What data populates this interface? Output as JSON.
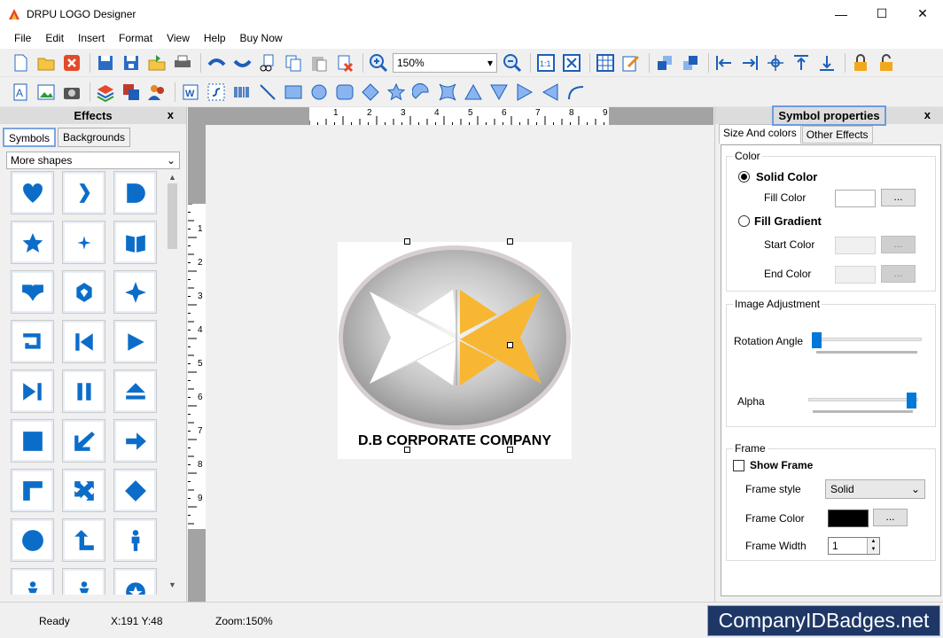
{
  "window": {
    "title": "DRPU LOGO Designer",
    "controls": {
      "minimize": "—",
      "maximize": "☐",
      "close": "✕"
    }
  },
  "menu": [
    "File",
    "Edit",
    "Insert",
    "Format",
    "View",
    "Help",
    "Buy Now"
  ],
  "toolbar": {
    "zoom_value": "150%",
    "icons_row1": [
      "new-icon",
      "open-icon",
      "close-doc-icon",
      "save-icon",
      "save-as-icon",
      "export-icon",
      "print-icon",
      "undo-icon",
      "redo-icon",
      "cut-icon",
      "copy-icon",
      "paste-icon",
      "delete-icon",
      "zoom-in-icon",
      "zoom-out-icon",
      "actual-size-icon",
      "fit-icon",
      "grid-icon",
      "edit-icon",
      "bring-front-icon",
      "send-back-icon",
      "align-left-icon",
      "align-right-icon",
      "align-center-icon",
      "align-top-icon",
      "align-bottom-icon",
      "lock-icon",
      "unlock-icon"
    ],
    "icons_row2": [
      "text-icon",
      "image-icon",
      "camera-icon",
      "layers-icon",
      "shapes-icon",
      "users-icon",
      "word-art-icon",
      "signature-icon",
      "barcode-icon",
      "line-icon",
      "rectangle-icon",
      "ellipse-icon",
      "rounded-rect-icon",
      "diamond-icon",
      "star-icon",
      "arc-icon",
      "star4-icon",
      "triangle-icon",
      "triangle-down-icon",
      "triangle-right-icon",
      "triangle-left-icon",
      "curve-icon"
    ]
  },
  "effects_panel": {
    "title": "Effects",
    "close": "x",
    "tabs": [
      "Symbols",
      "Backgrounds"
    ],
    "shape_category": "More shapes",
    "symbols": [
      "heart",
      "chevron-right",
      "d-shape",
      "star",
      "sparkle",
      "book-open",
      "book-heart",
      "shield-gem",
      "star4",
      "banner",
      "skip-back",
      "play",
      "skip-forward",
      "pause",
      "eject",
      "square",
      "arrow-down-left",
      "arrow-right",
      "corner",
      "expand",
      "diamond",
      "circle",
      "turn-up",
      "person",
      "person-small",
      "person-small",
      "badge"
    ]
  },
  "canvas": {
    "ruler_h": [
      "1",
      "2",
      "3",
      "4",
      "5",
      "6",
      "7",
      "8",
      "9"
    ],
    "ruler_v": [
      "1",
      "2",
      "3",
      "4",
      "5",
      "6",
      "7",
      "8",
      "9"
    ],
    "logo_text": "D.B CORPORATE COMPANY"
  },
  "symbol_properties": {
    "title": "Symbol properties",
    "close": "x",
    "tabs": [
      "Size And colors",
      "Other Effects"
    ],
    "color_group": "Color",
    "solid_color": "Solid Color",
    "fill_color": "Fill Color",
    "fill_gradient": "Fill Gradient",
    "start_color": "Start Color",
    "end_color": "End Color",
    "dots": "...",
    "image_adjustment": "Image Adjustment",
    "rotation_angle": "Rotation Angle",
    "alpha": "Alpha",
    "rotation_level": 0.0,
    "alpha_level": 1.0,
    "frame_group": "Frame",
    "show_frame": "Show Frame",
    "frame_style_label": "Frame style",
    "frame_style_value": "Solid",
    "frame_color_label": "Frame Color",
    "frame_color": "#000000",
    "frame_width_label": "Frame Width",
    "frame_width_value": "1"
  },
  "status": {
    "ready": "Ready",
    "coords": "X:191  Y:48",
    "zoom": "Zoom:150%"
  },
  "watermark": "CompanyIDBadges.net",
  "colors": {
    "accent": "#0c6dc9",
    "logo_orange": "#f7b733",
    "watermark_bg": "#1e3766"
  }
}
